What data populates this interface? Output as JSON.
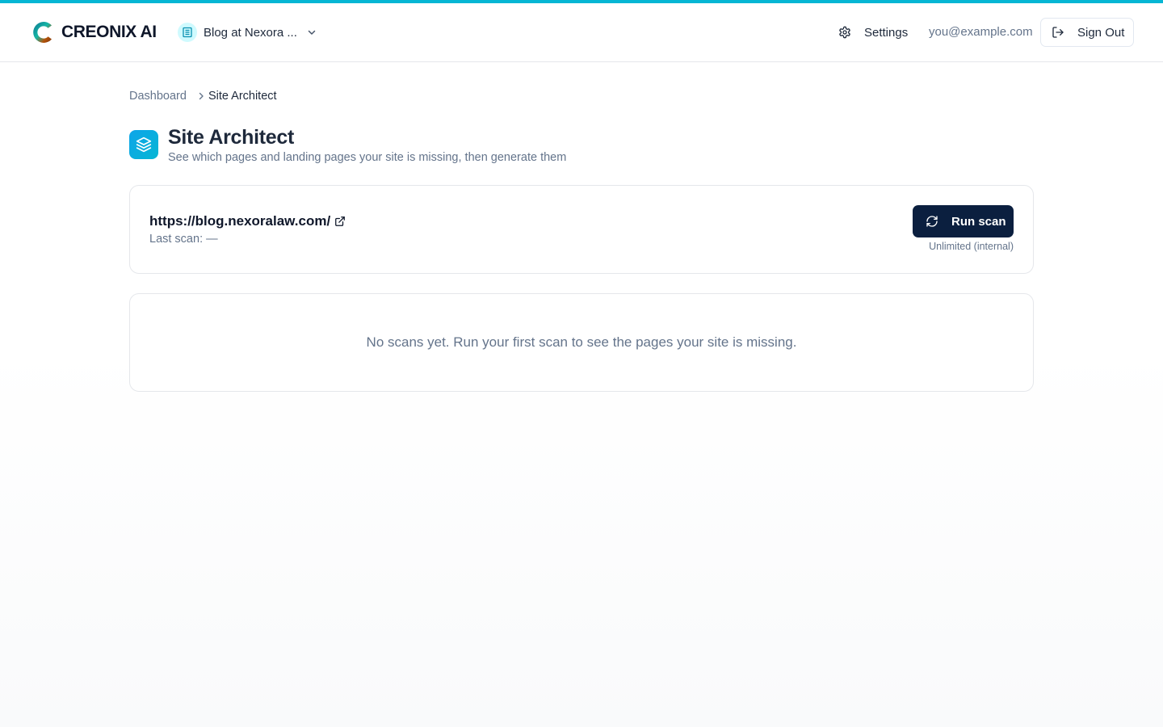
{
  "brand": {
    "name": "CREONIX AI",
    "logo_icon": "creonix-c-logo"
  },
  "site_switcher": {
    "selected": "Blog at Nexora ...",
    "icon": "site-icon"
  },
  "nav": {
    "settings_label": "Settings",
    "user_email": "you@example.com",
    "sign_out_label": "Sign Out"
  },
  "breadcrumb": {
    "parent": "Dashboard",
    "current": "Site Architect"
  },
  "page": {
    "title": "Site Architect",
    "subtitle": "See which pages and landing pages your site is missing, then generate them"
  },
  "site_card": {
    "url": "https://blog.nexoralaw.com/",
    "last_scan": "Last scan: —",
    "run_scan_label": "Run scan",
    "quota_note": "Unlimited (internal)"
  },
  "empty_state": {
    "message": "No scans yet. Run your first scan to see the pages your site is missing."
  },
  "colors": {
    "accent": "#06b6d4",
    "primary_button": "#0b1f3f",
    "muted_text": "#64748b",
    "border": "#e5e7eb"
  }
}
